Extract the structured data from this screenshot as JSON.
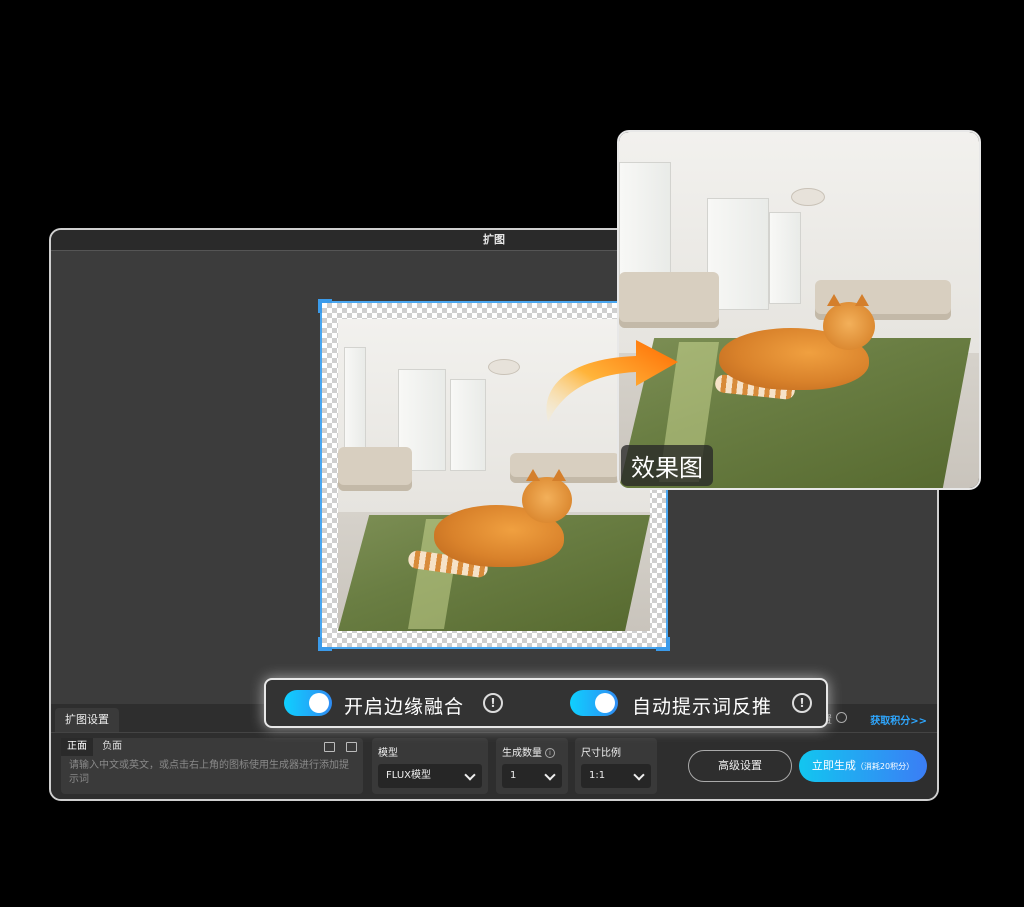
{
  "window": {
    "title": "扩图"
  },
  "settings": {
    "tab_label": "扩图设置",
    "get_points_link": "获取积分>>",
    "history_partial": "置",
    "prompt": {
      "tab_positive": "正面",
      "tab_negative": "负面",
      "placeholder": "请输入中文或英文，或点击右上角的图标使用生成器进行添加提示词"
    },
    "model": {
      "label": "模型",
      "value": "FLUX模型"
    },
    "count": {
      "label": "生成数量",
      "value": "1"
    },
    "ratio": {
      "label": "尺寸比例",
      "value": "1:1"
    },
    "advanced_button": "高级设置",
    "generate_button": "立即生成",
    "generate_cost": "（消耗20积分）"
  },
  "callout": {
    "edge_blend": {
      "label": "开启边缘融合",
      "enabled": true
    },
    "auto_prompt": {
      "label": "自动提示词反推",
      "enabled": true
    }
  },
  "result": {
    "label": "效果图"
  },
  "colors": {
    "accent": "#2ea7ff",
    "frame": "#4aa6ef",
    "toggle_on": "#1aa8f5"
  },
  "icons": [
    "warning-icon",
    "clock-icon",
    "chevron-down-icon",
    "info-icon",
    "generator-icon",
    "book-icon",
    "curved-arrow-icon"
  ]
}
